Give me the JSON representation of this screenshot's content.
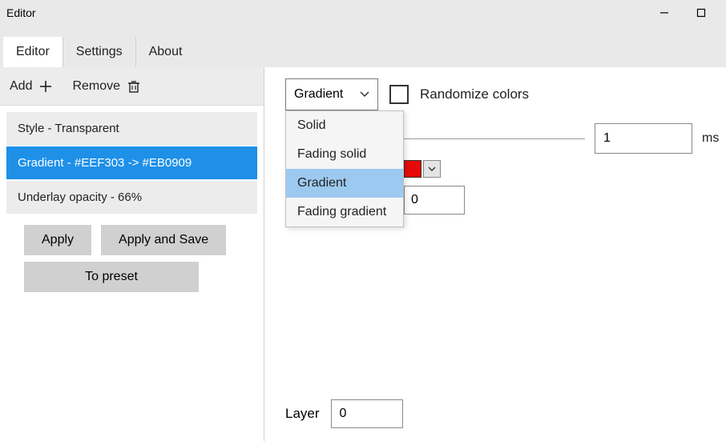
{
  "window": {
    "title": "Editor"
  },
  "tabs": [
    {
      "label": "Editor",
      "active": true
    },
    {
      "label": "Settings",
      "active": false
    },
    {
      "label": "About",
      "active": false
    }
  ],
  "sidebar": {
    "add_label": "Add",
    "remove_label": "Remove",
    "items": [
      {
        "label": "Style - Transparent",
        "selected": false
      },
      {
        "label": "Gradient - #EEF303 -> #EB0909",
        "selected": true
      },
      {
        "label": "Underlay opacity - 66%",
        "selected": false
      }
    ],
    "apply_label": "Apply",
    "apply_save_label": "Apply and Save",
    "to_preset_label": "To preset"
  },
  "main": {
    "type_select": {
      "value": "Gradient",
      "options": [
        "Solid",
        "Fading solid",
        "Gradient",
        "Fading gradient"
      ],
      "highlighted": "Gradient"
    },
    "randomize_label": "Randomize colors",
    "randomize_checked": false,
    "duration_value": "1",
    "duration_unit": "ms",
    "color_swatch": "#e80909",
    "number_field_value": "0",
    "layer_label": "Layer",
    "layer_value": "0"
  }
}
